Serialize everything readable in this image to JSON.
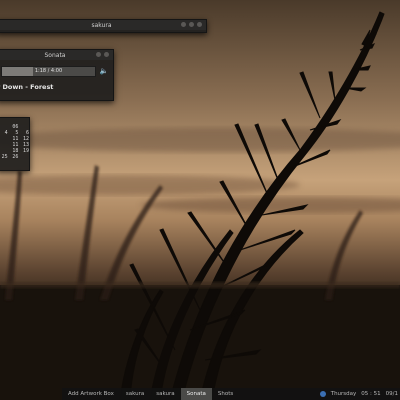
{
  "terminal": {
    "title": "sakura"
  },
  "player": {
    "title": "Sonata",
    "time_text": "1:18 / 4:00",
    "progress_fraction": 0.33,
    "song": "r Down - Forest",
    "volume_icon": "speaker-icon"
  },
  "calendar": {
    "rows": [
      [
        "",
        "06",
        ""
      ],
      [
        "4",
        "5",
        "6"
      ],
      [
        "",
        "11",
        "12"
      ],
      [
        "",
        "11",
        "13"
      ],
      [
        "",
        "18",
        "19"
      ],
      [
        "25",
        "26",
        ""
      ]
    ]
  },
  "taskbar": {
    "items": [
      {
        "label": "Add Artwork Box"
      },
      {
        "label": "sakura"
      },
      {
        "label": "sakura"
      },
      {
        "label": "Sonata"
      },
      {
        "label": "Shots"
      }
    ],
    "day": "Thursday",
    "time": "05 : 51",
    "date": "09/1"
  },
  "colors": {
    "sky_top": "#5a4632",
    "sky_glow": "#c9a47a",
    "ground": "#1a140e"
  }
}
